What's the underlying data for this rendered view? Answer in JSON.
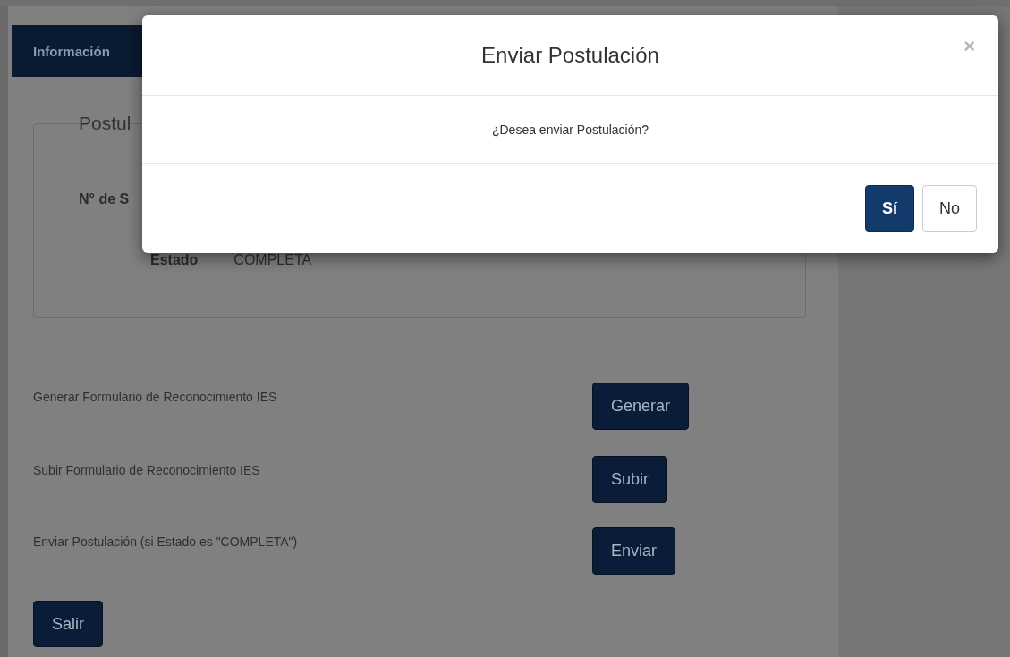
{
  "tabs": [
    {
      "label": "Información",
      "selected": true
    }
  ],
  "fieldset": {
    "legend": "Postul",
    "fields": [
      {
        "label": "N° de S"
      },
      {
        "label": "Estado",
        "value": "COMPLETA"
      }
    ]
  },
  "actions": [
    {
      "label": "Generar Formulario de Reconocimiento IES",
      "button": "Generar"
    },
    {
      "label": "Subir Formulario de Reconocimiento IES",
      "button": "Subir"
    },
    {
      "label": "Enviar Postulación (si Estado es \"COMPLETA\")",
      "button": "Enviar"
    }
  ],
  "exit_button": "Salir",
  "modal": {
    "title": "Enviar Postulación",
    "close": "×",
    "message": "¿Desea enviar Postulación?",
    "buttons": [
      {
        "label": "Sí",
        "kind": "primary"
      },
      {
        "label": "No",
        "kind": "default"
      }
    ]
  }
}
